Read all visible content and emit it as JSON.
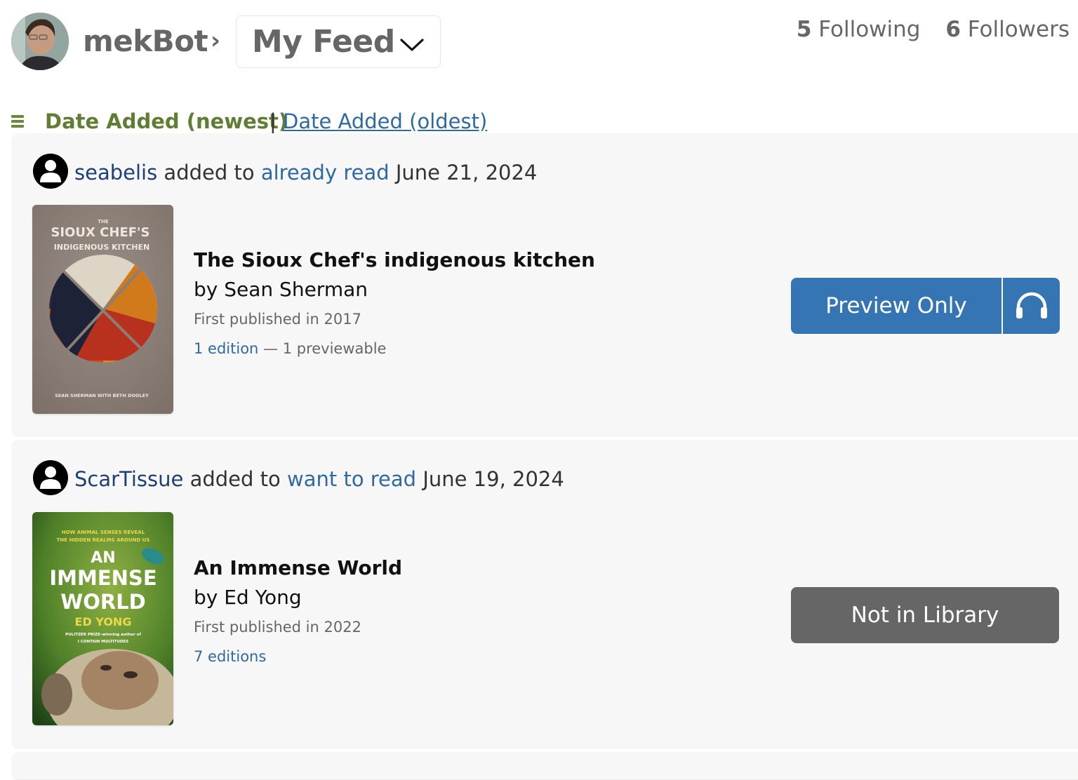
{
  "header": {
    "username": "mekBot",
    "breadcrumb_separator": "›",
    "feed_selector": {
      "selected": "My Feed",
      "icon": "chevron-down-icon"
    },
    "following": {
      "count": "5",
      "label": "Following"
    },
    "followers": {
      "count": "6",
      "label": "Followers"
    }
  },
  "sort": {
    "icon": "list-icon",
    "active": "Date Added (newest)",
    "separator": "|",
    "alternate": "Date Added (oldest)"
  },
  "feed": [
    {
      "user": "seabelis",
      "action": "added to",
      "shelf": "already read",
      "date": "June 21, 2024",
      "book": {
        "title": "The Sioux Chef's indigenous kitchen",
        "author": "by Sean Sherman",
        "first_published": "First published in 2017",
        "editions_link": "1 edition",
        "editions_extra": " — 1 previewable",
        "cover": {
          "top": "THE",
          "line1": "SIOUX CHEF'S",
          "line2": "INDIGENOUS KITCHEN",
          "credit": "SEAN SHERMAN WITH BETH DOOLEY"
        }
      },
      "button": {
        "label": "Preview Only",
        "secondary_icon": "headphones-icon",
        "color": "#3575b4"
      }
    },
    {
      "user": "ScarTissue",
      "action": "added to",
      "shelf": "want to read",
      "date": "June 19, 2024",
      "book": {
        "title": "An Immense World",
        "author": "by Ed Yong",
        "first_published": "First published in 2022",
        "editions_link": "7 editions",
        "editions_extra": "",
        "cover": {
          "tagline1": "HOW ANIMAL SENSES REVEAL",
          "tagline2": "THE HIDDEN REALMS AROUND US",
          "line1": "AN",
          "line2": "IMMENSE",
          "line3": "WORLD",
          "author": "ED YONG",
          "award1": "PULITZER PRIZE–winning author of",
          "award2": "I CONTAIN MULTITUDES"
        }
      },
      "button": {
        "label": "Not in Library",
        "color": "#666666"
      }
    }
  ],
  "colors": {
    "sort_active": "#5f7d33",
    "link": "#2e6aa1",
    "user_link": "#1e3f78",
    "card_bg": "#f7f7f7"
  }
}
